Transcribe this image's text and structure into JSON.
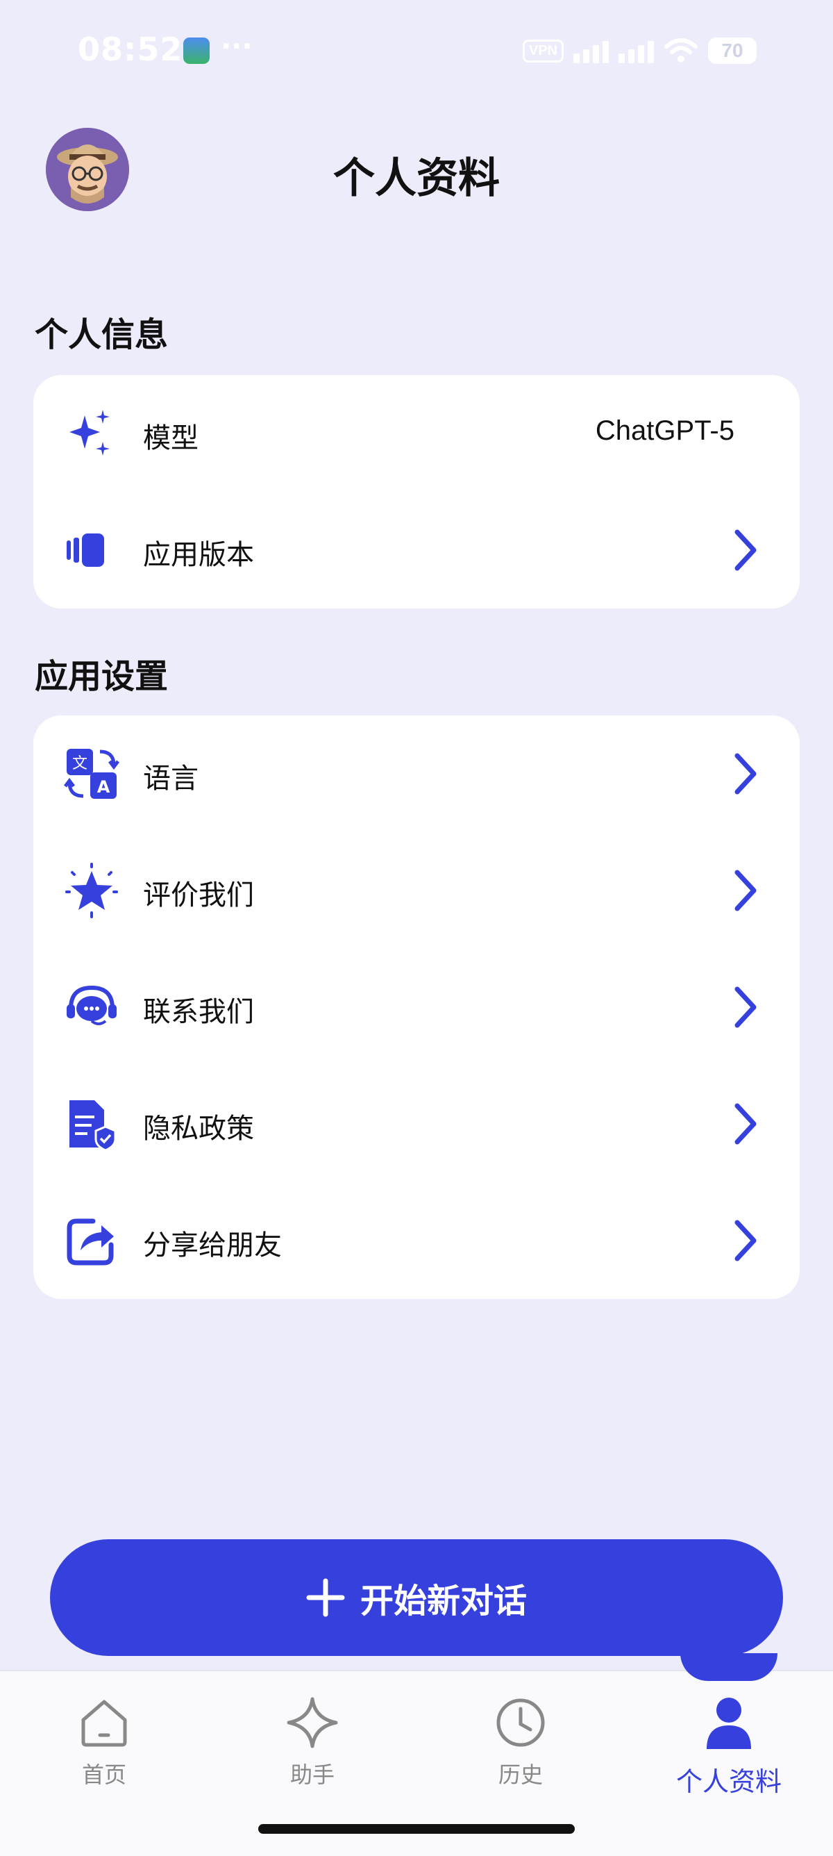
{
  "status_bar": {
    "time": "08:52",
    "dots": "···",
    "vpn": "VPN",
    "battery": "70"
  },
  "header": {
    "title": "个人资料"
  },
  "sections": {
    "personal_info": {
      "title": "个人信息",
      "rows": [
        {
          "label": "模型",
          "value": "ChatGPT-5",
          "icon": "sparkles-icon"
        },
        {
          "label": "应用版本",
          "icon": "app-version-icon"
        }
      ]
    },
    "app_settings": {
      "title": "应用设置",
      "rows": [
        {
          "label": "语言",
          "icon": "translate-icon"
        },
        {
          "label": "评价我们",
          "icon": "star-icon"
        },
        {
          "label": "联系我们",
          "icon": "support-chat-icon"
        },
        {
          "label": "隐私政策",
          "icon": "privacy-document-icon"
        },
        {
          "label": "分享给朋友",
          "icon": "share-icon"
        }
      ]
    }
  },
  "cta": {
    "label": "开始新对话"
  },
  "bottom_nav": {
    "items": [
      {
        "label": "首页",
        "icon": "home-icon"
      },
      {
        "label": "助手",
        "icon": "sparkle-icon"
      },
      {
        "label": "历史",
        "icon": "clock-icon"
      },
      {
        "label": "个人资料",
        "icon": "person-icon",
        "active": true
      }
    ]
  },
  "colors": {
    "accent": "#3640dc",
    "background": "#ececfa",
    "card": "#ffffff",
    "inactive": "#888888"
  }
}
